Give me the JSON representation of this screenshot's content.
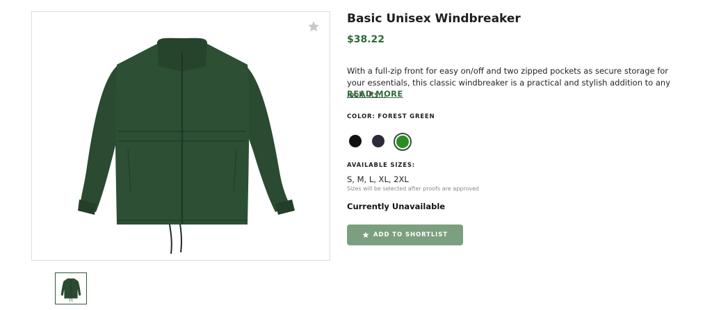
{
  "product": {
    "title": "Basic Unisex Windbreaker",
    "price": "$38.22",
    "description": "With a full-zip front for easy on/off and two zipped pockets as secure storage for your essentials, this classic windbreaker is a practical and stylish addition to any look. Its…",
    "read_more": "READ MORE",
    "color_label": "COLOR: FOREST GREEN",
    "colors": [
      {
        "name": "black",
        "hex": "#111111",
        "selected": false
      },
      {
        "name": "navy",
        "hex": "#2c2b3c",
        "selected": false
      },
      {
        "name": "forest green",
        "hex": "#2b8c23",
        "selected": true
      }
    ],
    "sizes_label": "AVAILABLE SIZES:",
    "sizes": "S, M, L, XL, 2XL",
    "sizes_note": "Sizes will be selected after proofs are approved",
    "availability": "Currently Unavailable",
    "shortlist_button": "ADD TO SHORTLIST",
    "jacket_color": "#2a4a31"
  },
  "icons": {
    "favorite": "star-icon",
    "button": "star-icon"
  },
  "colors": {
    "accent": "#2f6b39",
    "button_bg": "#7c9f80"
  }
}
